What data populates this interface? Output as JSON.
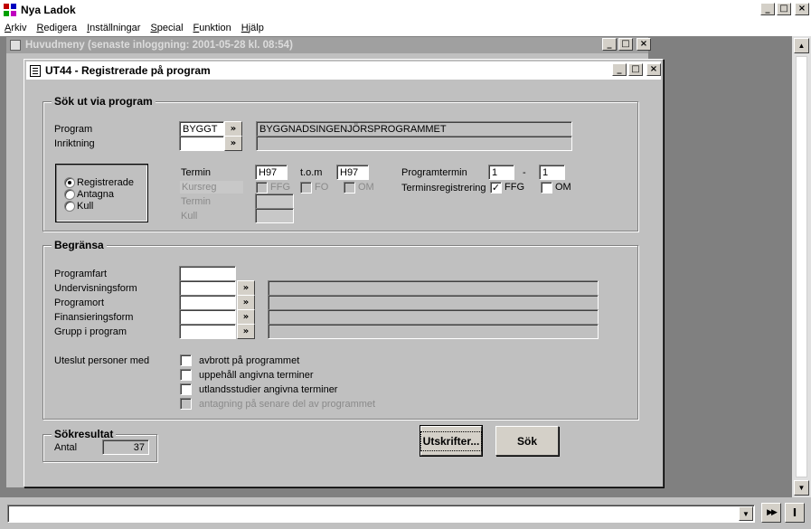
{
  "app": {
    "title": "Nya Ladok",
    "window_controls": {
      "minimize": "_",
      "maximize": "□",
      "close": "×"
    }
  },
  "menu": [
    {
      "label": "Arkiv",
      "mnemonic": "A",
      "rest": "rkiv"
    },
    {
      "label": "Redigera",
      "mnemonic": "R",
      "rest": "edigera"
    },
    {
      "label": "Inställningar",
      "mnemonic": "I",
      "rest": "nställningar"
    },
    {
      "label": "Special",
      "mnemonic": "S",
      "rest": "pecial"
    },
    {
      "label": "Funktion",
      "mnemonic": "F",
      "rest": "unktion"
    },
    {
      "label": "Hjälp",
      "mnemonic": "H",
      "rest": "jälp"
    }
  ],
  "background_window": {
    "title": "Huvudmeny    (senaste inloggning:  2001-05-28 kl. 08:54)"
  },
  "main_window": {
    "title": "UT44 - Registrerade på program",
    "search": {
      "group_title": "Sök ut via program",
      "program_label": "Program",
      "program_code": "BYGGT",
      "program_name": "BYGGNADSINGENJÖRSPROGRAMMET",
      "inriktning_label": "Inriktning",
      "inriktning_code": "",
      "inriktning_name": "",
      "lookup_label": "»",
      "radio_options": [
        {
          "label": "Registrerade",
          "selected": true
        },
        {
          "label": "Antagna",
          "selected": false
        },
        {
          "label": "Kull",
          "selected": false
        }
      ],
      "termin_label": "Termin",
      "termin_from": "H97",
      "tom_label": "t.o.m",
      "termin_to": "H97",
      "programtermin_label": "Programtermin",
      "programtermin_from": "1",
      "programtermin_dash": "-",
      "programtermin_to": "1",
      "kursreg_label": "Kursreg",
      "kursreg_checks": [
        "FFG",
        "FO",
        "OM"
      ],
      "disabled_termin_label": "Termin",
      "disabled_kull_label": "Kull",
      "terminsreg_label": "Terminsregistrering",
      "terminsreg_ffg_label": "FFG",
      "terminsreg_ffg_checked": true,
      "terminsreg_om_label": "OM",
      "terminsreg_om_checked": false
    },
    "limit": {
      "group_title": "Begränsa",
      "rows": [
        {
          "label": "Programfart",
          "code": "",
          "has_lookup": false,
          "name": ""
        },
        {
          "label": "Undervisningsform",
          "code": "",
          "has_lookup": true,
          "name": ""
        },
        {
          "label": "Programort",
          "code": "",
          "has_lookup": true,
          "name": ""
        },
        {
          "label": "Finansieringsform",
          "code": "",
          "has_lookup": true,
          "name": ""
        },
        {
          "label": "Grupp i program",
          "code": "",
          "has_lookup": true,
          "name": ""
        }
      ],
      "exclude_label": "Uteslut personer med",
      "exclude_options": [
        {
          "label": "avbrott på programmet",
          "checked": false,
          "disabled": false
        },
        {
          "label": "uppehåll angivna terminer",
          "checked": false,
          "disabled": false
        },
        {
          "label": "utlandsstudier angivna terminer",
          "checked": false,
          "disabled": false
        },
        {
          "label": "antagning på senare del av programmet",
          "checked": false,
          "disabled": true
        }
      ]
    },
    "result": {
      "group_title": "Sökresultat",
      "antal_label": "Antal",
      "antal_value": "37"
    },
    "buttons": {
      "print": "Utskrifter...",
      "search": "Sök"
    }
  },
  "statusbar": {
    "combo_value": "",
    "dropdown_glyph": "▼",
    "fast_forward_glyph": "▶▶",
    "cursor_glyph": "I"
  }
}
